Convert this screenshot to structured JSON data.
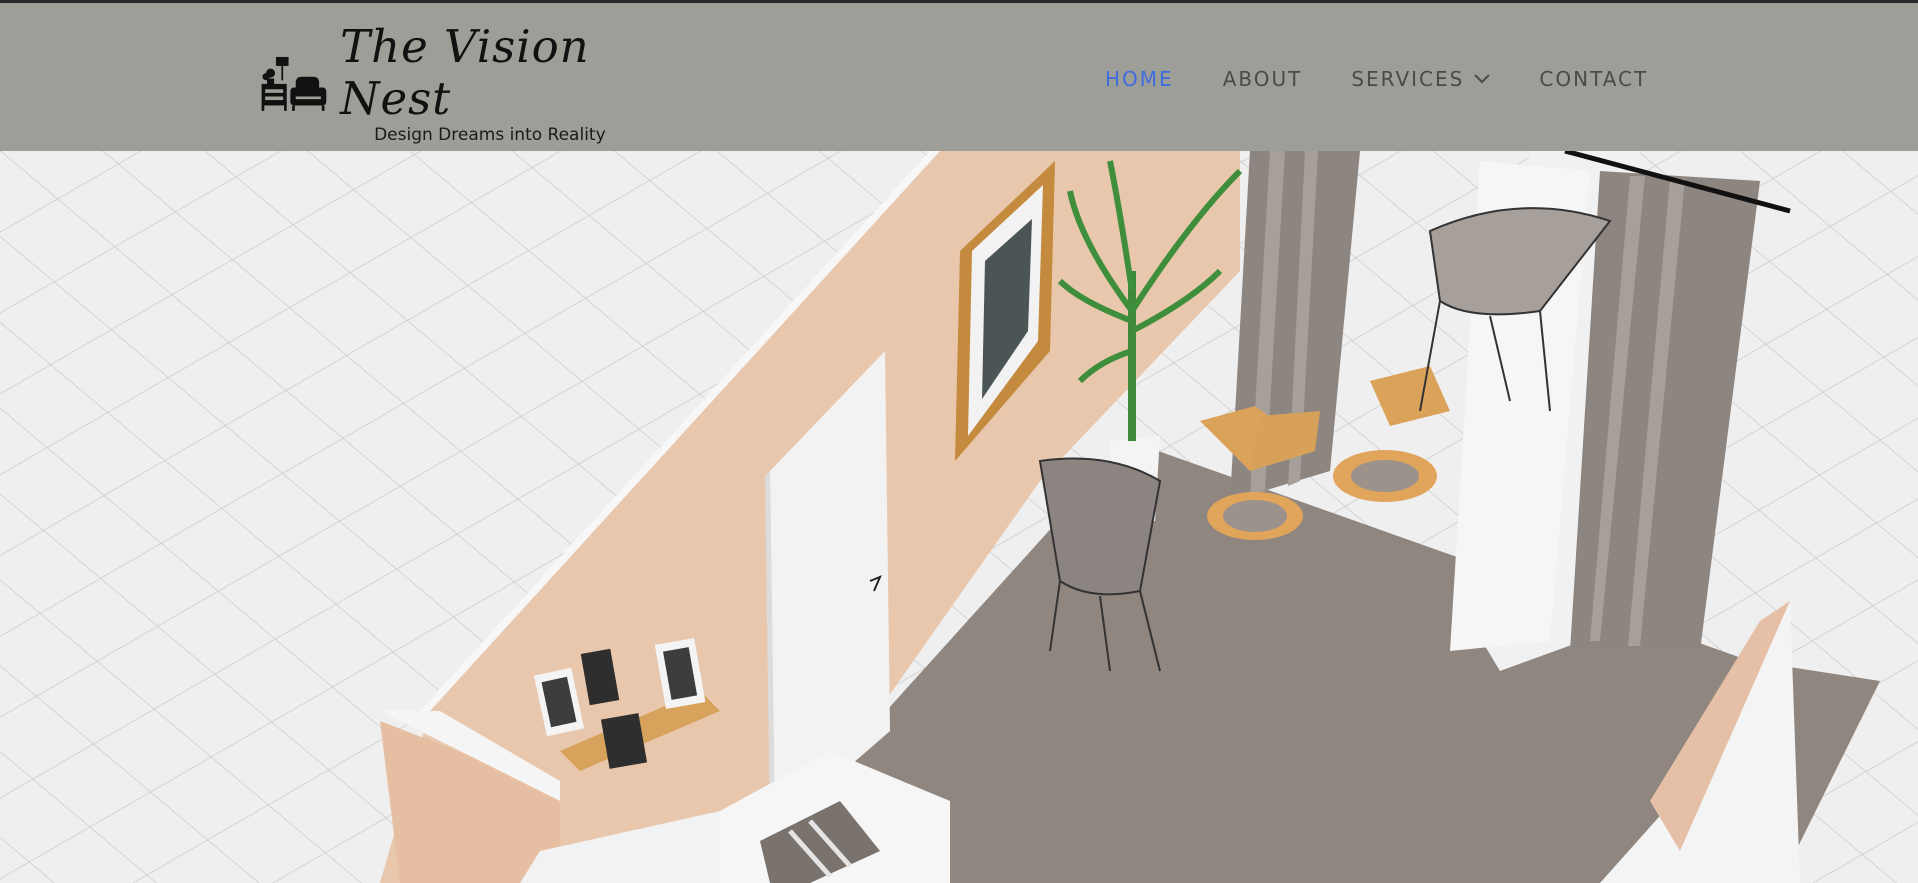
{
  "header": {
    "logo": {
      "icon": "furniture-logo-icon",
      "title": "The Vision Nest",
      "tagline": "Design Dreams into Reality"
    },
    "nav": [
      {
        "label": "HOME",
        "active": true
      },
      {
        "label": "ABOUT",
        "active": false
      },
      {
        "label": "SERVICES",
        "active": false,
        "dropdown": true
      },
      {
        "label": "CONTACT",
        "active": false
      }
    ]
  },
  "hero": {
    "image": "isometric-living-room-render"
  },
  "colors": {
    "header_bg": "#9e9e98",
    "nav_active": "#3d6de0",
    "nav_text": "#4a4a4a"
  }
}
